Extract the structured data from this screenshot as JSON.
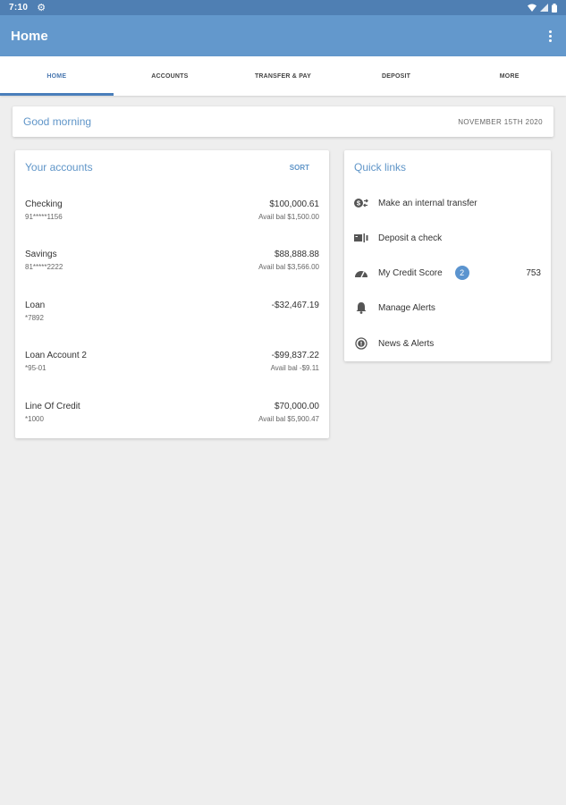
{
  "status_bar": {
    "time": "7:10"
  },
  "app_bar": {
    "title": "Home"
  },
  "tabs": [
    {
      "label": "HOME",
      "active": true
    },
    {
      "label": "ACCOUNTS",
      "active": false
    },
    {
      "label": "TRANSFER & PAY",
      "active": false
    },
    {
      "label": "DEPOSIT",
      "active": false
    },
    {
      "label": "MORE",
      "active": false
    }
  ],
  "greeting": {
    "text": "Good morning",
    "date": "NOVEMBER 15TH 2020"
  },
  "accounts": {
    "title": "Your accounts",
    "sort_label": "SORT",
    "items": [
      {
        "name": "Checking",
        "number": "91*****1156",
        "balance": "$100,000.61",
        "available": "Avail bal $1,500.00"
      },
      {
        "name": "Savings",
        "number": "81*****2222",
        "balance": "$88,888.88",
        "available": "Avail bal $3,566.00"
      },
      {
        "name": "Loan",
        "number": "*7892",
        "balance": "-$32,467.19",
        "available": ""
      },
      {
        "name": "Loan Account 2",
        "number": "*95-01",
        "balance": "-$99,837.22",
        "available": "Avail bal -$9.11"
      },
      {
        "name": "Line Of Credit",
        "number": "*1000",
        "balance": "$70,000.00",
        "available": "Avail bal $5,900.47"
      }
    ]
  },
  "quick_links": {
    "title": "Quick links",
    "items": [
      {
        "label": "Make an internal transfer",
        "icon": "transfer-icon"
      },
      {
        "label": "Deposit a check",
        "icon": "check-deposit-icon"
      },
      {
        "label": "My Credit Score",
        "icon": "gauge-icon",
        "badge": "2",
        "score": "753"
      },
      {
        "label": "Manage Alerts",
        "icon": "bell-icon"
      },
      {
        "label": "News & Alerts",
        "icon": "info-icon"
      }
    ]
  },
  "colors": {
    "status_bar": "#4f7fb3",
    "app_bar": "#6398cc",
    "accent": "#5f95c8",
    "background": "#eeeeee"
  }
}
